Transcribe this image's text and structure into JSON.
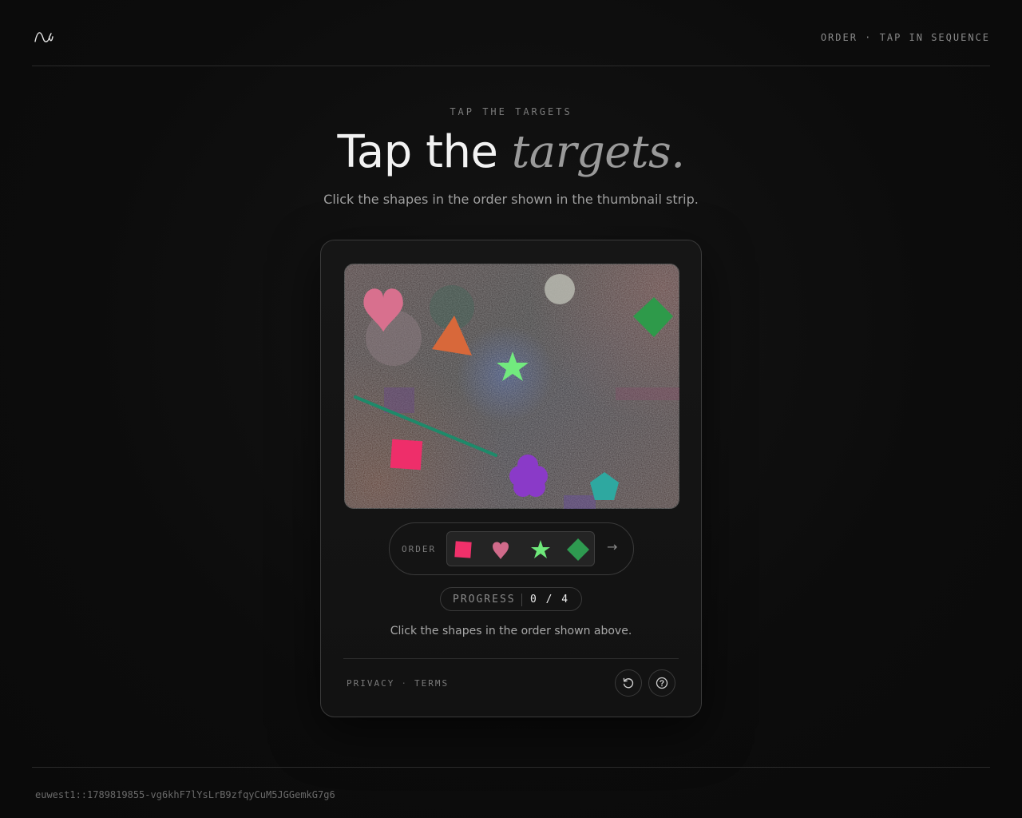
{
  "header": {
    "logo_icon": "wave-logo-icon",
    "tag": "ORDER · TAP IN SEQUENCE"
  },
  "hero": {
    "eyebrow": "TAP THE TARGETS",
    "title_plain": "Tap the ",
    "title_italic": "targets.",
    "subtitle": "Click the shapes in the order shown in the thumbnail strip."
  },
  "challenge": {
    "canvas_shapes": [
      "heart-shape",
      "circle-shape",
      "triangle-shape",
      "star-shape",
      "diamond-shape",
      "square-shape",
      "flower-shape",
      "pentagon-shape",
      "line-distractor"
    ],
    "order_label": "ORDER",
    "order_items": [
      {
        "icon": "square-icon",
        "color": "#f0306a"
      },
      {
        "icon": "heart-icon",
        "color": "#d06a8a"
      },
      {
        "icon": "star-icon",
        "color": "#6ee87a"
      },
      {
        "icon": "diamond-icon",
        "color": "#2e9a50"
      }
    ],
    "next_arrow": "→",
    "progress_label": "PROGRESS",
    "progress_value": "0 / 4",
    "progress_current": 0,
    "progress_total": 4,
    "instruction": "Click the shapes in the order shown above."
  },
  "card_footer": {
    "privacy": "PRIVACY",
    "separator": "·",
    "terms": "TERMS",
    "reload_icon": "reload-icon",
    "help_icon": "help-icon"
  },
  "footer": {
    "session_id": "euwest1::1789819855-vg6khF7lYsLrB9zfqyCuM5JGGemkG7g6"
  }
}
